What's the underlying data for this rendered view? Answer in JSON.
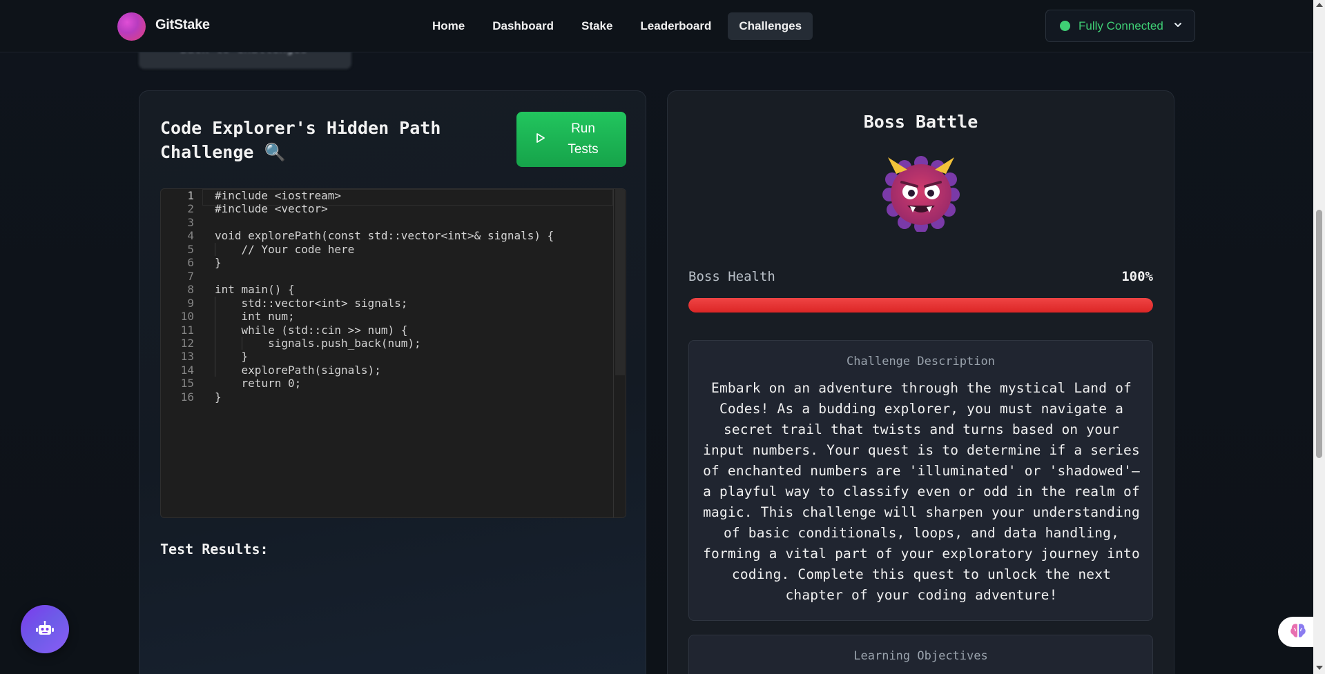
{
  "brand": {
    "name": "GitStake"
  },
  "nav": {
    "links": [
      "Home",
      "Dashboard",
      "Stake",
      "Leaderboard",
      "Challenges"
    ],
    "active": "Challenges"
  },
  "connection": {
    "label": "Fully Connected",
    "status_color": "#3fcf75"
  },
  "back_button": {
    "label": "Back to Challenges"
  },
  "challenge": {
    "title": "Code Explorer's Hidden Path Challenge",
    "title_emoji": "🔍",
    "run_button": "Run Tests",
    "code_lines": [
      "#include <iostream>",
      "#include <vector>",
      "",
      "void explorePath(const std::vector<int>& signals) {",
      "    // Your code here",
      "}",
      "",
      "int main() {",
      "    std::vector<int> signals;",
      "    int num;",
      "    while (std::cin >> num) {",
      "        signals.push_back(num);",
      "    }",
      "    explorePath(signals);",
      "    return 0;",
      "}"
    ],
    "test_results_label": "Test Results:"
  },
  "boss": {
    "title": "Boss Battle",
    "health_label": "Boss Health",
    "health_percent_text": "100%",
    "health_fraction": 1.0,
    "health_color": "#ef4444"
  },
  "description": {
    "heading": "Challenge Description",
    "text": "Embark on an adventure through the mystical Land of Codes! As a budding explorer, you must navigate a secret trail that twists and turns based on your input numbers. Your quest is to determine if a series of enchanted numbers are 'illuminated' or 'shadowed'—a playful way to classify even or odd in the realm of magic. This challenge will sharpen your understanding of basic conditionals, loops, and data handling, forming a vital part of your exploratory journey into coding. Complete this quest to unlock the next chapter of your coding adventure!"
  },
  "objectives": {
    "heading": "Learning Objectives"
  },
  "icons": {
    "connection": "status-dot-icon",
    "dropdown": "chevron-down-icon",
    "run": "play-icon",
    "boss": "ogre-face-icon",
    "assistant": "robot-icon",
    "brain": "brain-icon"
  }
}
